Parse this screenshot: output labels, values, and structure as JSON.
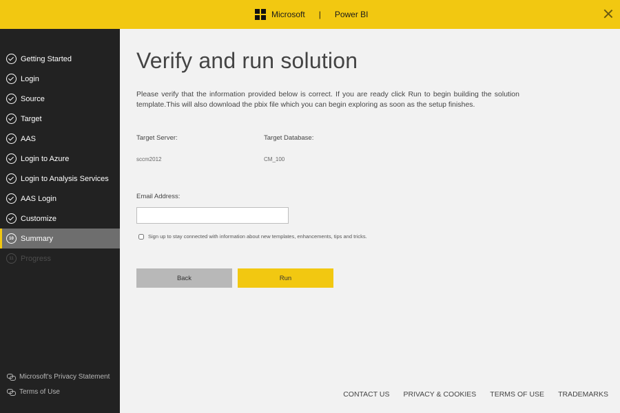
{
  "header": {
    "brand": "Microsoft",
    "separator": "|",
    "product": "Power BI",
    "close_icon": "close-icon"
  },
  "sidebar": {
    "steps": [
      {
        "label": "Getting Started",
        "state": "done",
        "icon": "check-circle-icon"
      },
      {
        "label": "Login",
        "state": "done",
        "icon": "check-circle-icon"
      },
      {
        "label": "Source",
        "state": "done",
        "icon": "check-circle-icon"
      },
      {
        "label": "Target",
        "state": "done",
        "icon": "check-circle-icon"
      },
      {
        "label": "AAS",
        "state": "done",
        "icon": "check-circle-icon"
      },
      {
        "label": "Login to Azure",
        "state": "done",
        "icon": "check-circle-icon"
      },
      {
        "label": "Login to Analysis Services",
        "state": "done",
        "icon": "check-circle-icon"
      },
      {
        "label": "AAS Login",
        "state": "done",
        "icon": "check-circle-icon"
      },
      {
        "label": "Customize",
        "state": "done",
        "icon": "check-circle-icon"
      },
      {
        "label": "Summary",
        "state": "active",
        "number": "10"
      },
      {
        "label": "Progress",
        "state": "disabled",
        "number": "11"
      }
    ],
    "links": [
      {
        "label": "Microsoft's Privacy Statement",
        "icon": "link-icon"
      },
      {
        "label": "Terms of Use",
        "icon": "link-icon"
      }
    ],
    "accent_color": "#f2c811"
  },
  "main": {
    "title": "Verify and run solution",
    "description": "Please verify that the information provided below is correct. If you are ready click Run to begin building the solution template.This will also download the pbix file which you can begin exploring as soon as the setup finishes.",
    "target_server_label": "Target Server:",
    "target_server_value": "sccm2012",
    "target_database_label": "Target Database:",
    "target_database_value": "CM_100",
    "email_label": "Email Address:",
    "email_value": "",
    "email_placeholder": "",
    "signup_label": "Sign up to stay connected with information about new templates, enhancements, tips and tricks.",
    "signup_checked": false,
    "back_label": "Back",
    "run_label": "Run"
  },
  "footer": {
    "links": [
      "CONTACT US",
      "PRIVACY & COOKIES",
      "TERMS OF USE",
      "TRADEMARKS"
    ]
  }
}
